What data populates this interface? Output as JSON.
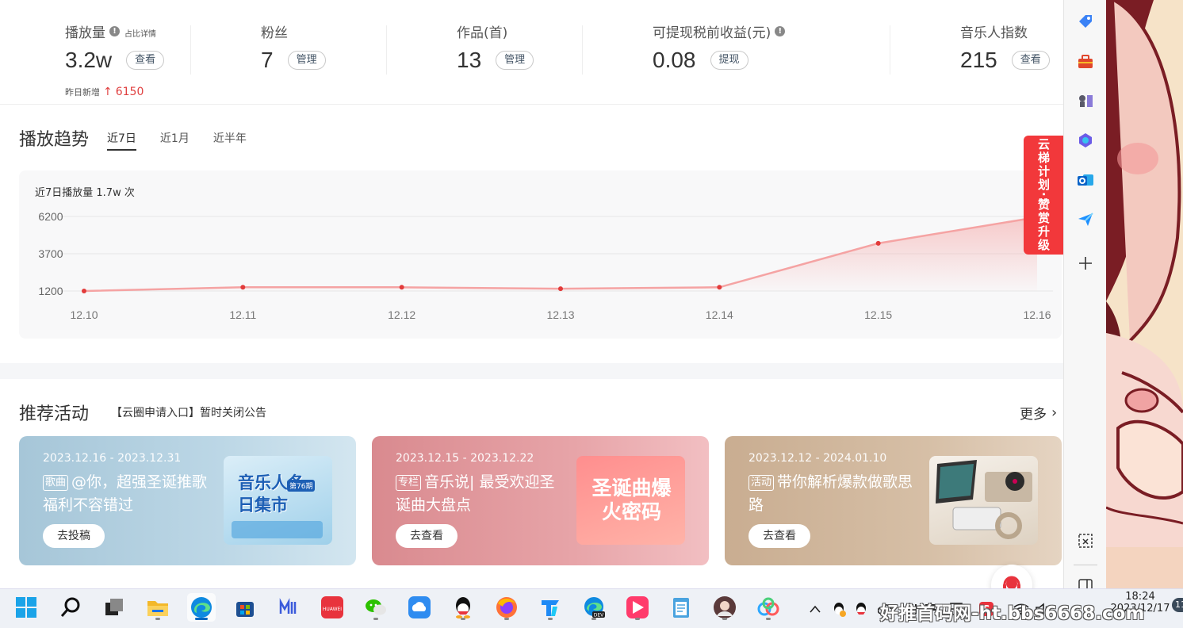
{
  "stats": [
    {
      "label": "播放量",
      "extra": "占比详情",
      "value": "3.2w",
      "action": "查看"
    },
    {
      "label": "粉丝",
      "value": "7",
      "action": "管理"
    },
    {
      "label": "作品(首)",
      "value": "13",
      "action": "管理"
    },
    {
      "label": "可提现税前收益(元)",
      "value": "0.08",
      "action": "提现"
    },
    {
      "label": "音乐人指数",
      "value": "215",
      "action": "查看"
    }
  ],
  "yesterday_new": {
    "label": "昨日新增",
    "arrow": "↑",
    "value": "6150"
  },
  "trend": {
    "title": "播放趋势",
    "tabs": [
      {
        "label": "近7日",
        "active": true
      },
      {
        "label": "近1月",
        "active": false
      },
      {
        "label": "近半年",
        "active": false
      }
    ],
    "caption": "近7日播放量 1.7w 次"
  },
  "chart_data": {
    "type": "area",
    "x": [
      "12.10",
      "12.11",
      "12.12",
      "12.13",
      "12.14",
      "12.15",
      "12.16"
    ],
    "values": [
      1200,
      1450,
      1450,
      1350,
      1450,
      4400,
      6150
    ],
    "ylim": [
      1200,
      6200
    ],
    "yticks": [
      "6200",
      "3700",
      "1200"
    ],
    "line_color": "#f5a3a3",
    "point_color": "#e23b3b"
  },
  "promo_banner": "云梯计划·赞赏升级",
  "activities": {
    "title": "推荐活动",
    "notice": "【云圈申请入口】暂时关闭公告",
    "more": "更多",
    "cards": [
      {
        "date": "2023.12.16 - 2023.12.31",
        "tag": "歌曲",
        "text": "@你，超强圣诞推歌福利不容错过",
        "button": "去投稿",
        "thumb_title": "音乐人冬日集市",
        "thumb_badge": "第76期"
      },
      {
        "date": "2023.12.15 - 2023.12.22",
        "tag": "专栏",
        "text": "音乐说| 最受欢迎圣诞曲大盘点",
        "button": "去查看",
        "thumb_title": "圣诞曲爆火密码"
      },
      {
        "date": "2023.12.12 - 2024.01.10",
        "tag": "活动",
        "text": "带你解析爆款做歌思路",
        "button": "去查看"
      }
    ]
  },
  "sidebar_icons": [
    "tag-icon",
    "toolbox-icon",
    "chess-icon",
    "office-icon",
    "outlook-icon",
    "send-icon",
    "add-icon",
    "screenshot-icon",
    "panel-icon"
  ],
  "taskbar": {
    "apps": [
      "start",
      "search",
      "task-view",
      "file-explorer",
      "edge",
      "store",
      "app-m",
      "huawei-appgallery",
      "wechat",
      "cloud-drive",
      "qq",
      "firefox",
      "todesk",
      "edge-dev",
      "video-app",
      "notepad",
      "avatar-app",
      "baidu-netdisk"
    ],
    "clock_time": "18:24",
    "clock_date": "2023/12/17",
    "notifications": "11",
    "watermark": "好推首码网-ht.bbs6668.com"
  },
  "colors": {
    "accent_red": "#e04040",
    "banner_red": "#f2383b"
  }
}
